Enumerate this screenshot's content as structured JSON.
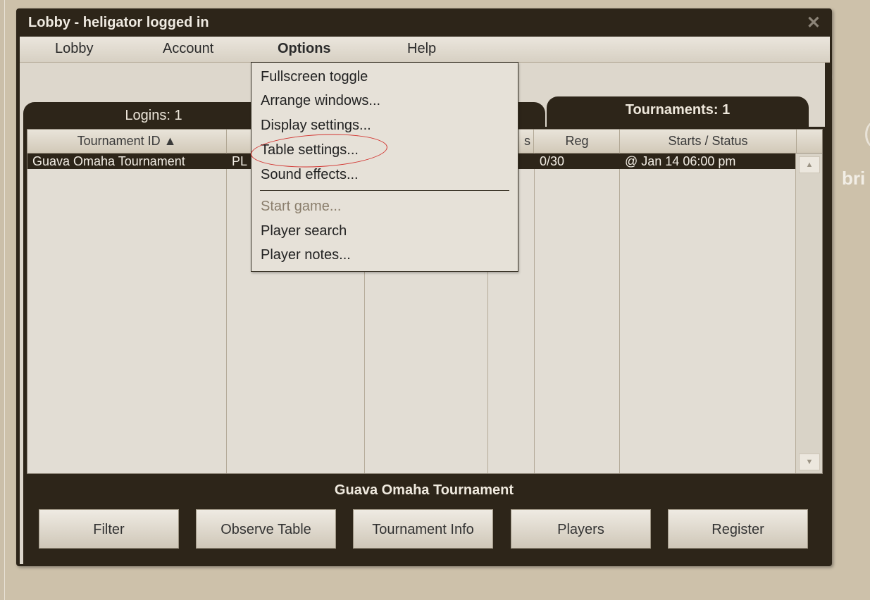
{
  "window": {
    "title": "Lobby - heligator logged in",
    "close_glyph": "✕"
  },
  "menubar": {
    "items": [
      {
        "label": "Lobby"
      },
      {
        "label": "Account"
      },
      {
        "label": "Options"
      },
      {
        "label": "Help"
      }
    ],
    "active": "Options"
  },
  "tabs": {
    "logins": "Logins: 1",
    "tournaments": "Tournaments: 1"
  },
  "table": {
    "headers": {
      "tournament_id": "Tournament ID ▲",
      "col_game": "",
      "col_buyin": "",
      "col_s": "s",
      "reg": "Reg",
      "starts_status": "Starts / Status"
    },
    "rows": [
      {
        "tournament_id": "Guava Omaha Tournament",
        "game": "PL",
        "reg": "0/30",
        "starts_status": "@ Jan 14 06:00 pm"
      }
    ]
  },
  "selected_tournament": "Guava Omaha Tournament",
  "buttons": {
    "filter": "Filter",
    "observe": "Observe Table",
    "info": "Tournament Info",
    "players": "Players",
    "register": "Register"
  },
  "options_menu": {
    "items": [
      "Fullscreen toggle",
      "Arrange windows...",
      "Display settings...",
      "Table settings...",
      "Sound effects...",
      "Start game...",
      "Player search",
      "Player notes..."
    ],
    "disabled": [
      "Start game..."
    ]
  },
  "annotation": {
    "color": "#d2332f",
    "circled_item": "Table settings..."
  },
  "background_text": "bri",
  "colors": {
    "dark": "#2d2519",
    "panel": "#e2ddd4",
    "outer": "#cbbfa9"
  }
}
